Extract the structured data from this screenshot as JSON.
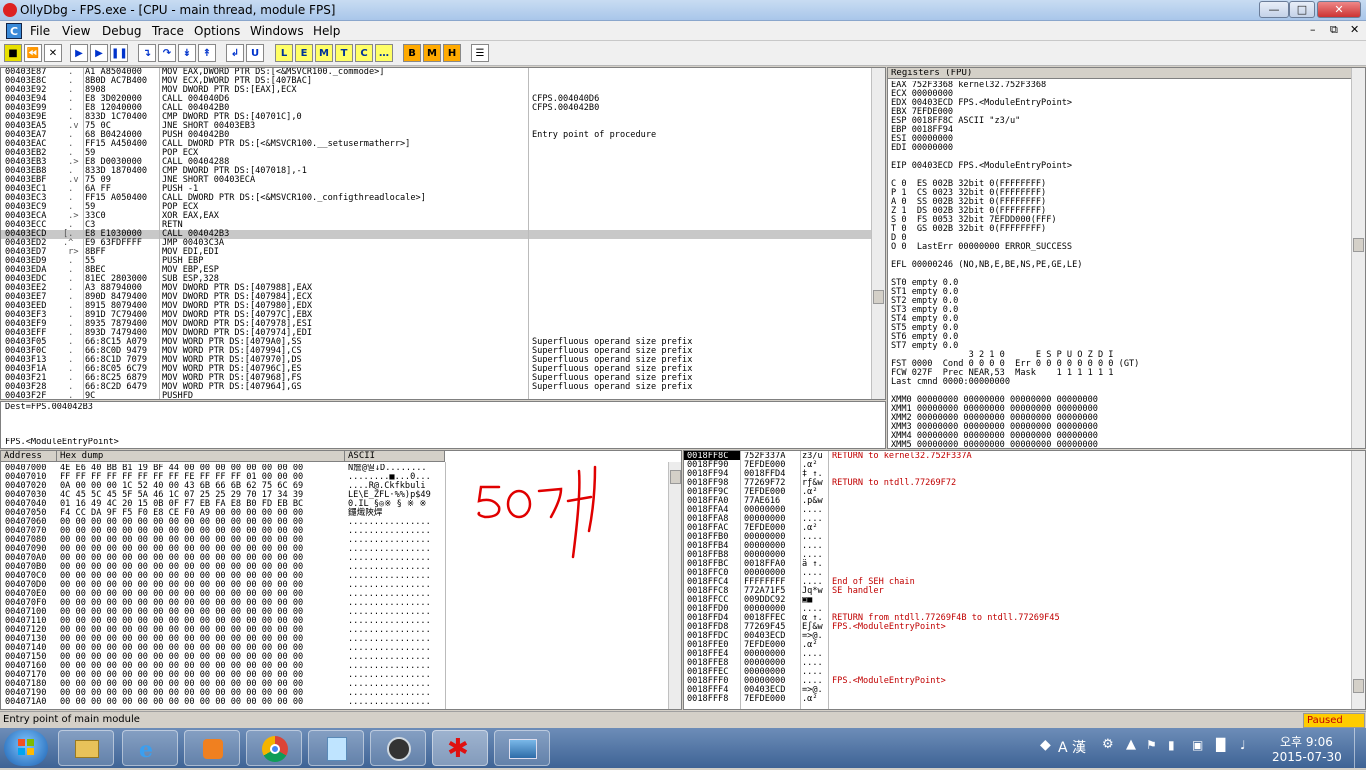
{
  "window": {
    "title": "OllyDbg - FPS.exe - [CPU - main thread, module FPS]"
  },
  "menu": [
    "File",
    "View",
    "Debug",
    "Trace",
    "Options",
    "Windows",
    "Help"
  ],
  "toolbar_letters": [
    "L",
    "E",
    "M",
    "T",
    "C",
    "…",
    "B",
    "M",
    "H"
  ],
  "disasm": {
    "addresses": "00403E87\n00403E8C\n00403E92\n00403E94\n00403E99\n00403E9E\n00403EA5\n00403EA7\n00403EAC\n00403EB2\n00403EB3\n00403EB8\n00403EBF\n00403EC1\n00403EC3\n00403EC9\n00403ECA\n00403ECC\n00403ECD\n00403ED2\n00403ED7\n00403ED9\n00403EDA\n00403EDC\n00403EE2\n00403EE7\n00403EED\n00403EF3\n00403EF9\n00403EFF\n00403F05\n00403F0C\n00403F13\n00403F1A\n00403F21\n00403F28\n00403F2F",
    "marks": " .\n .\n .\n .\n .\n .\n .v\n .\n .\n .\n .>\n .\n .v\n .\n .\n .\n .>\n .\n[.\n.^\n r>\n .\n .\n .\n .\n .\n .\n .\n .\n .\n .\n .\n .\n .\n .\n .\n .",
    "hex": "A1 A8504000\n8B0D AC7B400\n8908\nE8 3D020000\nE8 12040000\n833D 1C70400\n75 0C\n68 B0424000\nFF15 A450400\n59\nE8 D0030000\n833D 1870400\n75 09\n6A FF\nFF15 A050400\n59\n33C0\nC3\nE8 E1030000\nE9 63FDFFFF\n8BFF\n55\n8BEC\n81EC 2803000\nA3 88794000\n890D 8479400\n8915 8079400\n891D 7C79400\n8935 7879400\n893D 7479400\n66:8C15 A079\n66:8C0D 9479\n66:8C1D 7079\n66:8C05 6C79\n66:8C25 6879\n66:8C2D 6479\n9C",
    "code": "MOV EAX,DWORD PTR DS:[<&MSVCR100._commode>]\nMOV ECX,DWORD PTR DS:[407BAC]\nMOV DWORD PTR DS:[EAX],ECX\nCALL 004040D6\nCALL 004042B0\nCMP DWORD PTR DS:[40701C],0\nJNE SHORT 00403EB3\nPUSH 004042B0\nCALL DWORD PTR DS:[<&MSVCR100.__setusermatherr>]\nPOP ECX\nCALL 00404288\nCMP DWORD PTR DS:[407018],-1\nJNE SHORT 00403ECA\nPUSH -1\nCALL DWORD PTR DS:[<&MSVCR100._configthreadlocale>]\nPOP ECX\nXOR EAX,EAX\nRETN\nCALL 004042B3\nJMP 00403C3A\nMOV EDI,EDI\nPUSH EBP\nMOV EBP,ESP\nSUB ESP,328\nMOV DWORD PTR DS:[407988],EAX\nMOV DWORD PTR DS:[407984],ECX\nMOV DWORD PTR DS:[407980],EDX\nMOV DWORD PTR DS:[40797C],EBX\nMOV DWORD PTR DS:[407978],ESI\nMOV DWORD PTR DS:[407974],EDI\nMOV WORD PTR DS:[4079A0],SS\nMOV WORD PTR DS:[407994],CS\nMOV WORD PTR DS:[407970],DS\nMOV WORD PTR DS:[40796C],ES\nMOV WORD PTR DS:[407968],FS\nMOV WORD PTR DS:[407964],GS\nPUSHFD",
    "comments": "\n\n\nCFPS.004040D6\nCFPS.004042B0\n\n\nEntry point of procedure\n\n\n\n\n\n\n\n\n\n\n\n\n\n\n\n\n\n\n\n\n\n\nSuperfluous operand size prefix\nSuperfluous operand size prefix\nSuperfluous operand size prefix\nSuperfluous operand size prefix\nSuperfluous operand size prefix\nSuperfluous operand size prefix\n",
    "selected_address": "00403ECD"
  },
  "info": {
    "line1": "Dest=FPS.004042B3",
    "line2": "FPS.<ModuleEntryPoint>"
  },
  "registers": {
    "title": "Registers (FPU)",
    "main": "EAX 752F3368 kernel32.752F3368\nECX 00000000\nEDX 00403ECD FPS.<ModuleEntryPoint>\nEBX 7EFDE000\nESP 0018FF8C ASCII \"z3/u\"\nEBP 0018FF94\nESI 00000000\nEDI 00000000\n\nEIP 00403ECD FPS.<ModuleEntryPoint>\n\nC 0  ES 002B 32bit 0(FFFFFFFF)\nP 1  CS 0023 32bit 0(FFFFFFFF)\nA 0  SS 002B 32bit 0(FFFFFFFF)\nZ 1  DS 002B 32bit 0(FFFFFFFF)\nS 0  FS 0053 32bit 7EFDD000(FFF)\nT 0  GS 002B 32bit 0(FFFFFFFF)\nD 0\nO 0  LastErr 00000000 ERROR_SUCCESS\n\nEFL 00000246 (NO,NB,E,BE,NS,PE,GE,LE)\n\nST0 empty 0.0\nST1 empty 0.0\nST2 empty 0.0\nST3 empty 0.0\nST4 empty 0.0\nST5 empty 0.0\nST6 empty 0.0\nST7 empty 0.0\n               3 2 1 0      E S P U O Z D I\nFST 0000  Cond 0 0 0 0  Err 0 0 0 0 0 0 0 0 (GT)\nFCW 027F  Prec NEAR,53  Mask    1 1 1 1 1 1\nLast cmnd 0000:00000000\n\nXMM0 00000000 00000000 00000000 00000000\nXMM1 00000000 00000000 00000000 00000000\nXMM2 00000000 00000000 00000000 00000000\nXMM3 00000000 00000000 00000000 00000000\nXMM4 00000000 00000000 00000000 00000000\nXMM5 00000000 00000000 00000000 00000000\nXMM6 00000000 00000000 00000000 00000000\nXMM7 00000000 00000000 00000000 00000000"
  },
  "dump": {
    "headers": {
      "address": "Address",
      "hex": "Hex dump",
      "ascii": "ASCII"
    },
    "addresses": "00407000\n00407010\n00407020\n00407030\n00407040\n00407050\n00407060\n00407070\n00407080\n00407090\n004070A0\n004070B0\n004070C0\n004070D0\n004070E0\n004070F0\n00407100\n00407110\n00407120\n00407130\n00407140\n00407150\n00407160\n00407170\n00407180\n00407190\n004071A0",
    "hex": "4E E6 40 BB B1 19 BF 44 00 00 00 00 00 00 00 00\nFF FF FF FF FF FF FF FF FE FF FF FF 01 00 00 00\n0A 00 00 00 1C 52 40 00 43 6B 66 6B 62 75 6C 69\n4C 45 5C 45 5F 5A 46 1C 07 25 25 29 70 17 34 39\n01 16 49 4C 20 15 0B 0F F7 EB FA E8 B0 FD EB BC\nF4 CC DA 9F F5 F0 E8 CE F0 A9 00 00 00 00 00 00\n00 00 00 00 00 00 00 00 00 00 00 00 00 00 00 00\n00 00 00 00 00 00 00 00 00 00 00 00 00 00 00 00\n00 00 00 00 00 00 00 00 00 00 00 00 00 00 00 00\n00 00 00 00 00 00 00 00 00 00 00 00 00 00 00 00\n00 00 00 00 00 00 00 00 00 00 00 00 00 00 00 00\n00 00 00 00 00 00 00 00 00 00 00 00 00 00 00 00\n00 00 00 00 00 00 00 00 00 00 00 00 00 00 00 00\n00 00 00 00 00 00 00 00 00 00 00 00 00 00 00 00\n00 00 00 00 00 00 00 00 00 00 00 00 00 00 00 00\n00 00 00 00 00 00 00 00 00 00 00 00 00 00 00 00\n00 00 00 00 00 00 00 00 00 00 00 00 00 00 00 00\n00 00 00 00 00 00 00 00 00 00 00 00 00 00 00 00\n00 00 00 00 00 00 00 00 00 00 00 00 00 00 00 00\n00 00 00 00 00 00 00 00 00 00 00 00 00 00 00 00\n00 00 00 00 00 00 00 00 00 00 00 00 00 00 00 00\n00 00 00 00 00 00 00 00 00 00 00 00 00 00 00 00\n00 00 00 00 00 00 00 00 00 00 00 00 00 00 00 00\n00 00 00 00 00 00 00 00 00 00 00 00 00 00 00 00\n00 00 00 00 00 00 00 00 00 00 00 00 00 00 00 00\n00 00 00 00 00 00 00 00 00 00 00 00 00 00 00 00\n00 00 00 00 00 00 00 00 00 00 00 00 00 00 00 00",
    "ascii": "N詹@띨↓D........\n........■...0...\n....R@.Ckfkbuli\nLE\\E_ZFL·%%)p$49\n0.IL §◎※ § ※ ※\n鑼熾陝焊\n................\n................\n................\n................\n................\n................\n................\n................\n................\n................\n................\n................\n................\n................\n................\n................\n................\n................\n................\n................\n................",
    "annotation": "50개"
  },
  "stack": {
    "addresses": "0018FF8C\n0018FF90\n0018FF94\n0018FF98\n0018FF9C\n0018FFA0\n0018FFA4\n0018FFA8\n0018FFAC\n0018FFB0\n0018FFB4\n0018FFB8\n0018FFBC\n0018FFC0\n0018FFC4\n0018FFC8\n0018FFCC\n0018FFD0\n0018FFD4\n0018FFD8\n0018FFDC\n0018FFE0\n0018FFE4\n0018FFE8\n0018FFEC\n0018FFF0\n0018FFF4\n0018FFF8",
    "values": "752F337A\n7EFDE000\n0018FFD4\n77269F72\n7EFDE000\n77AE616\n00000000\n00000000\n7EFDE000\n00000000\n00000000\n00000000\n0018FFA0\n00000000\nFFFFFFFF\n772A71F5\n009DDC92\n00000000\n0018FFEC\n77269F45\n00403ECD\n7EFDE000\n00000000\n00000000\n00000000\n00000000\n00403ECD\n7EFDE000",
    "ascii": "z3/u\n.α²\n‡ ↑.\nrƒ&w\n.α²\n.p&w\n....\n....\n.α²\n....\n....\n....\nä ↑.\n....\n....\nJq*w\n▣■\n....\nα ↑.\nE∫&w\n=>@.\n.α²\n....\n....\n....\n....\n=>@.\n.α²",
    "comments": "RETURN to kernel32.752F337A\n\n\nRETURN to ntdll.77269F72\n\n\n\n\n\n\n\n\n\n\nEnd of SEH chain\nSE handler\n\n\nRETURN from ntdll.77269F4B to ntdll.77269F45\nFPS.<ModuleEntryPoint>\n\n\n\n\n\nFPS.<ModuleEntryPoint>\n"
  },
  "status": {
    "left": "Entry point of main module",
    "right": "Paused"
  },
  "tray": {
    "ime": "A 漢",
    "time": "오후 9:06",
    "date": "2015-07-30"
  },
  "colors": {
    "accent_red": "#c00000",
    "paused_bg": "#ffcc00"
  }
}
